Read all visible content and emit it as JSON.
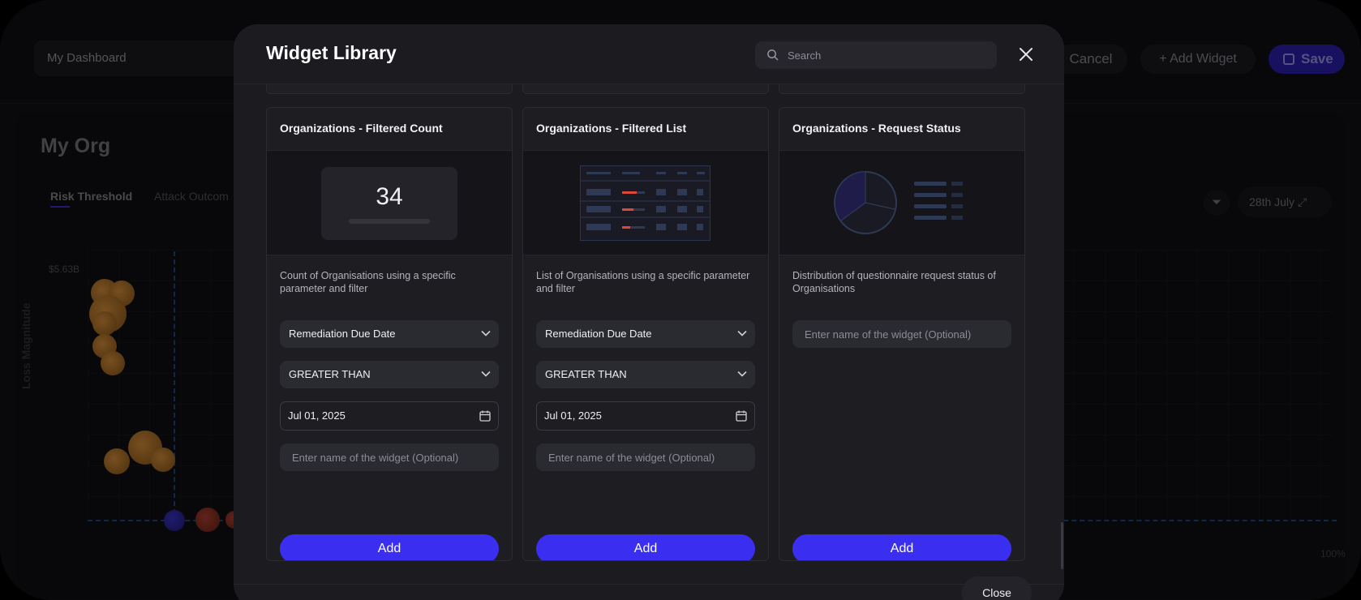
{
  "background": {
    "dashboard_name": "My Dashboard",
    "cancel_label": "Cancel",
    "add_widget_label": "Add Widget",
    "save_label": "Save",
    "org_title": "My Org",
    "tabs": [
      "Risk Threshold",
      "Attack Outcom"
    ],
    "date_label": "28th July",
    "y_axis_label": "Loss Magnitude",
    "y_max_label": "$5.63B",
    "x_max_label": "100%"
  },
  "modal": {
    "title": "Widget Library",
    "search_placeholder": "Search",
    "close_label": "Close"
  },
  "cards": [
    {
      "title": "Organizations - Filtered Count",
      "preview_value": "34",
      "description": "Count of Organisations using a specific parameter and filter",
      "field_select": "Remediation Due Date",
      "operator_select": "GREATER THAN",
      "date_value": "Jul 01, 2025",
      "name_placeholder": "Enter name of the widget (Optional)",
      "add_label": "Add"
    },
    {
      "title": "Organizations - Filtered List",
      "description": "List of Organisations using a specific parameter and filter",
      "field_select": "Remediation Due Date",
      "operator_select": "GREATER THAN",
      "date_value": "Jul 01, 2025",
      "name_placeholder": "Enter name of the widget (Optional)",
      "add_label": "Add"
    },
    {
      "title": "Organizations - Request Status",
      "description": "Distribution of questionnaire request status of Organisations",
      "name_placeholder": "Enter name of the widget (Optional)",
      "add_label": "Add"
    }
  ],
  "colors": {
    "accent": "#3a2ff0",
    "modal_bg": "#1b1b20",
    "card_bg": "#1d1d22",
    "danger": "#e0453a"
  }
}
